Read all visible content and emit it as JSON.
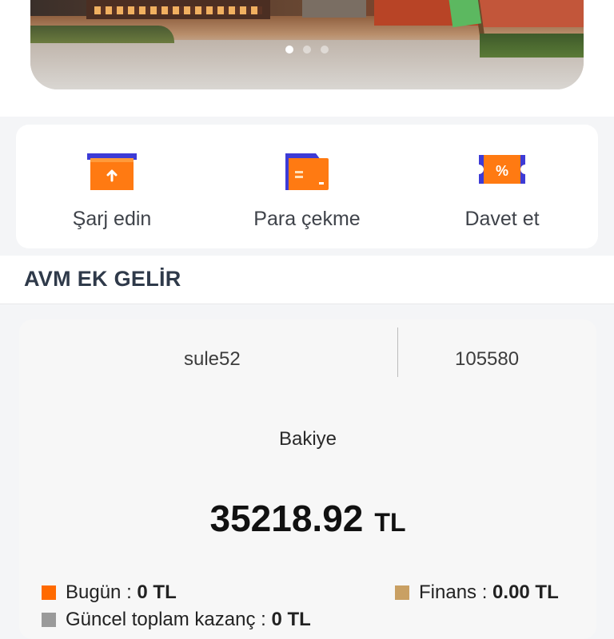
{
  "banner": {
    "slides": 3,
    "active_slide": 1
  },
  "actions": [
    {
      "label": "Şarj edin",
      "icon": "recharge-icon"
    },
    {
      "label": "Para çekme",
      "icon": "withdraw-icon"
    },
    {
      "label": "Davet et",
      "icon": "invite-coupon-icon"
    }
  ],
  "section": {
    "title": "AVM EK GELİR"
  },
  "account": {
    "username": "sule52",
    "user_id": "105580",
    "balance_label": "Bakiye",
    "balance": "35218.92",
    "currency": "TL",
    "today_label": "Bugün :",
    "today_value": "0 TL",
    "finance_label": "Finans :",
    "finance_value": "0.00 TL",
    "third_label": "Güncel toplam kazanç :",
    "third_value": "0 TL"
  },
  "colors": {
    "accent_orange": "#ff6a00",
    "finance_tan": "#c9a063",
    "third_gray": "#9a9a9a",
    "title_navy": "#2f3a4a"
  }
}
